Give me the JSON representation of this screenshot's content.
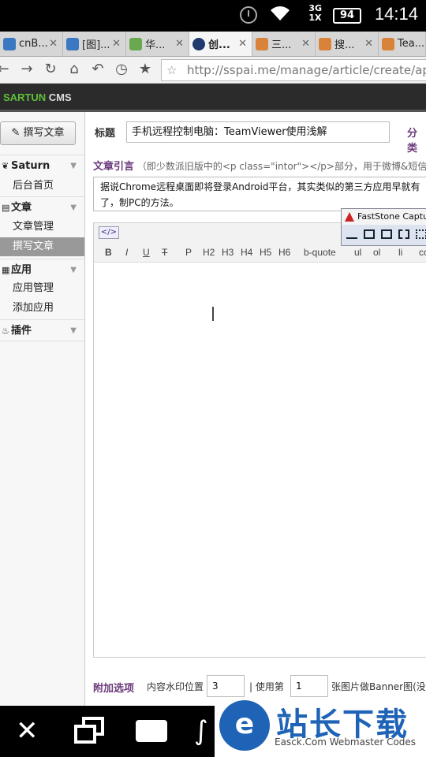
{
  "status_bar": {
    "net_top": "3G",
    "net_bottom": "1X",
    "battery": "94",
    "time": "14:14"
  },
  "tabs": [
    {
      "label": "cnB...",
      "active": false,
      "color": "#3a78c2"
    },
    {
      "label": "[图]...",
      "active": false,
      "color": "#3a78c2"
    },
    {
      "label": "华...",
      "active": false,
      "color": "#6aa84f"
    },
    {
      "label": "创...",
      "active": true,
      "color": "#1e3a6e"
    },
    {
      "label": "三...",
      "active": false,
      "color": "#d9833a"
    },
    {
      "label": "搜...",
      "active": false,
      "color": "#d9833a"
    },
    {
      "label": "Tea...",
      "active": false,
      "color": "#d9833a"
    }
  ],
  "toolbar": {
    "url": "http://sspai.me/manage/article/create/appid/"
  },
  "cms": {
    "brand_green": "SARTUN",
    "brand_white": "CMS"
  },
  "sidebar": {
    "write_button": "撰写文章",
    "sections": [
      {
        "label": "Saturn",
        "items": [
          "后台首页"
        ]
      },
      {
        "label": "文章",
        "items": [
          "文章管理",
          "撰写文章"
        ],
        "selected": "撰写文章"
      },
      {
        "label": "应用",
        "items": [
          "应用管理",
          "添加应用"
        ]
      },
      {
        "label": "插件",
        "items": []
      }
    ]
  },
  "form": {
    "title_label": "标题",
    "title_value": "手机远程控制电脑：TeamViewer使用浅解",
    "category_label": "分类",
    "excerpt_label": "文章引言",
    "excerpt_hint": "（即少数派旧版中的<p class=\"intor\"></p>部分，用于微博&短信分享",
    "excerpt_value": "据说Chrome远程桌面即将登录Android平台，其实类似的第三方应用早就有了，制PC的方法。",
    "editor_buttons": [
      "B",
      "I",
      "U",
      "T",
      "P",
      "H2",
      "H3",
      "H4",
      "H5",
      "H6",
      "b-quote",
      "ul",
      "ol",
      "li",
      "co"
    ],
    "code_button": "</>",
    "options_label": "附加选项",
    "watermark_label": "内容水印位置",
    "watermark_value": "3",
    "use_label": "| 使用第",
    "banner_index": "1",
    "banner_label": "张图片做Banner图(没有"
  },
  "faststone": {
    "title": "FastStone Capture"
  },
  "watermark": {
    "logo": "e",
    "cn": "站长下载",
    "en": "Easck.Com Webmaster Codes"
  }
}
